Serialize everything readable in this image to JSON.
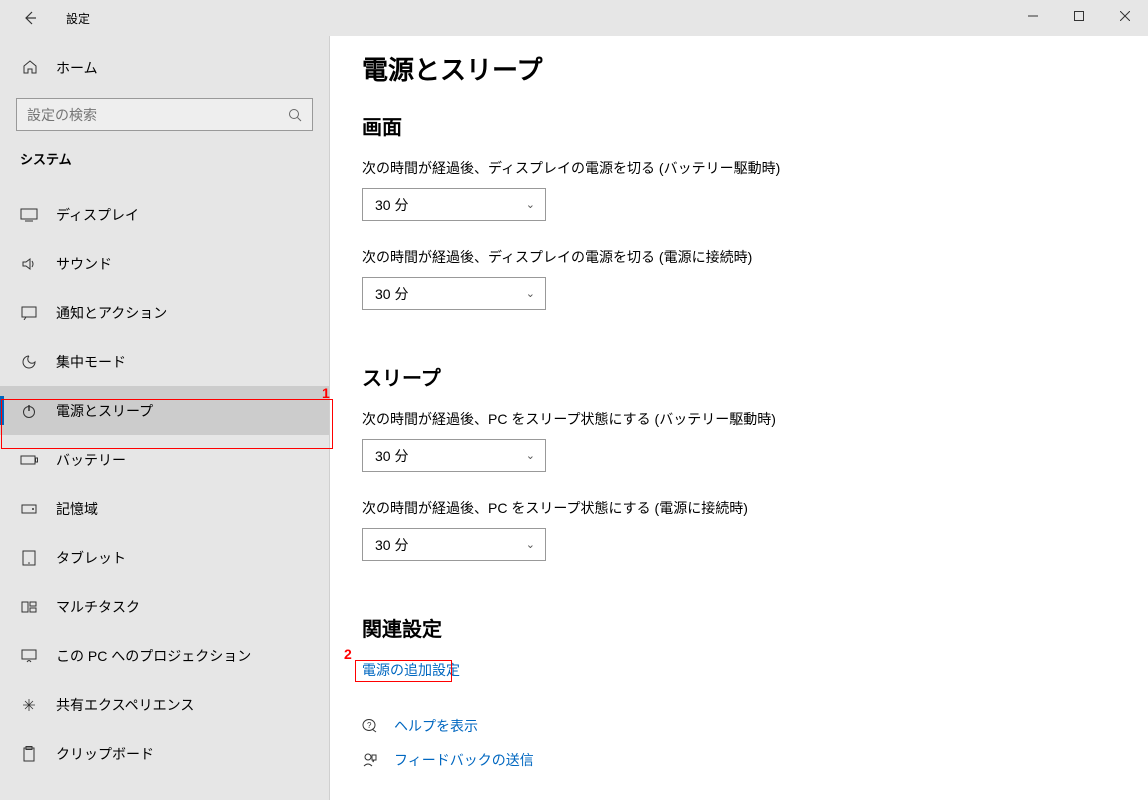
{
  "titlebar": {
    "title": "設定"
  },
  "home": {
    "label": "ホーム"
  },
  "search": {
    "placeholder": "設定の検索"
  },
  "category": "システム",
  "nav": [
    {
      "label": "ディスプレイ"
    },
    {
      "label": "サウンド"
    },
    {
      "label": "通知とアクション"
    },
    {
      "label": "集中モード"
    },
    {
      "label": "電源とスリープ"
    },
    {
      "label": "バッテリー"
    },
    {
      "label": "記憶域"
    },
    {
      "label": "タブレット"
    },
    {
      "label": "マルチタスク"
    },
    {
      "label": "この PC へのプロジェクション"
    },
    {
      "label": "共有エクスペリエンス"
    },
    {
      "label": "クリップボード"
    }
  ],
  "page": {
    "title": "電源とスリープ",
    "screen_section": "画面",
    "screen_battery_label": "次の時間が経過後、ディスプレイの電源を切る (バッテリー駆動時)",
    "screen_battery_value": "30 分",
    "screen_plugged_label": "次の時間が経過後、ディスプレイの電源を切る (電源に接続時)",
    "screen_plugged_value": "30 分",
    "sleep_section": "スリープ",
    "sleep_battery_label": "次の時間が経過後、PC をスリープ状態にする (バッテリー駆動時)",
    "sleep_battery_value": "30 分",
    "sleep_plugged_label": "次の時間が経過後、PC をスリープ状態にする (電源に接続時)",
    "sleep_plugged_value": "30 分",
    "related_section": "関連設定",
    "related_link": "電源の追加設定",
    "help_link": "ヘルプを表示",
    "feedback_link": "フィードバックの送信"
  },
  "annotations": {
    "one": "1",
    "two": "2"
  }
}
